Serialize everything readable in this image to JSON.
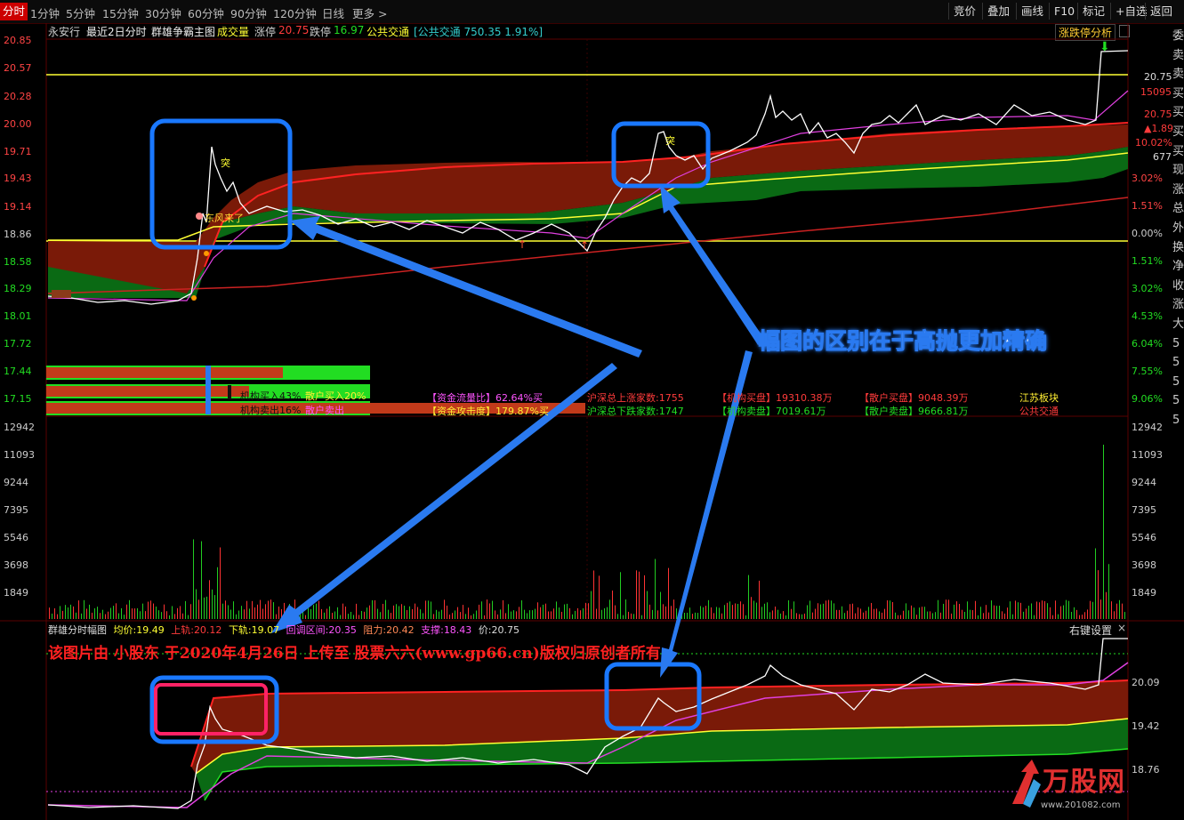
{
  "toolbar": {
    "periods": [
      "分时",
      "1分钟",
      "5分钟",
      "15分钟",
      "30分钟",
      "60分钟",
      "90分钟",
      "120分钟",
      "日线",
      "更多 >"
    ],
    "buttons": [
      "竞价",
      "叠加",
      "画线",
      "F10",
      "标记",
      "+自选",
      "返回"
    ]
  },
  "info": {
    "stock_name": "永安行",
    "range": "最近2日分时",
    "indicator": "群雄争霸主图",
    "volume_label": "成交量",
    "limit_up_label": "涨停",
    "limit_up_value": "20.75",
    "limit_down_label": "跌停",
    "limit_down_value": "16.97",
    "sector": "公共交通",
    "sector_quote": "[公共交通 750.35 1.91%]",
    "analysis_btn": "涨跌停分析"
  },
  "left_axis": [
    "20.85",
    "20.57",
    "20.28",
    "20.00",
    "19.71",
    "19.43",
    "19.14",
    "18.86",
    "18.58",
    "18.29",
    "18.01",
    "17.72",
    "17.44",
    "17.15"
  ],
  "right_axis": {
    "pct": [
      "3.02%",
      "1.51%",
      "0.00%",
      "1.51%",
      "3.02%",
      "4.53%",
      "6.04%",
      "7.55%",
      "9.06%"
    ],
    "labels": [
      "20.75",
      "15095",
      "20.75",
      "▲1.89",
      "10.02%",
      "677"
    ]
  },
  "side_chars": [
    "委",
    "卖",
    "卖",
    "买",
    "买",
    "买",
    "买",
    "现",
    "涨",
    "总",
    "外",
    "换",
    "净",
    "收",
    "涨",
    "大",
    "5",
    "5",
    "5",
    "5",
    "5"
  ],
  "stats": {
    "inst_buy": "机构买入43%",
    "retail_buy": "散户买入20%",
    "inst_sell": "机构卖出16%",
    "retail_sell": "散户卖出",
    "fund_flow": "【资金流量比】62.64%买",
    "fund_attack": "【资金攻击度】179.87%买",
    "up_count": "沪深总上涨家数:1755",
    "down_count": "沪深总下跌家数:1747",
    "inst_buy_amt": "【机构买盘】19310.38万",
    "inst_sell_amt": "【机构卖盘】7019.61万",
    "retail_buy_amt": "【散户买盘】9048.39万",
    "retail_sell_amt": "【散户卖盘】9666.81万",
    "board": "江苏板块",
    "board_sector": "公共交通"
  },
  "volume_axis": [
    "12942",
    "11093",
    "9244",
    "7395",
    "5546",
    "3698",
    "1849"
  ],
  "sub_chart": {
    "title": "群雄分时幅图",
    "avg_label": "均价:",
    "avg": "19.49",
    "upper_label": "上轨:",
    "upper": "20.12",
    "lower_label": "下轨:",
    "lower": "19.07",
    "zone_label": "回调区间:",
    "zone": "20.35",
    "resist_label": "阻力:",
    "resist": "20.42",
    "support_label": "支撑:",
    "support": "18.43",
    "price_label": "价:",
    "price": "20.75",
    "settings": "右键设置",
    "close": "×",
    "axis": [
      "20.09",
      "19.42",
      "18.76"
    ]
  },
  "annotations": {
    "callout": "幅图的区别在于高抛更加精确",
    "signal_tu": "突",
    "signal_dongfeng": "东风来了",
    "watermark": "该图片由 小股东 于2020年4月26日 上传至 股票六六(www.gp66.cn)版权归原创者所有",
    "logo": "万股网",
    "logo_url": "www.201082.com"
  },
  "colors": {
    "up": "#ff3b3b",
    "down": "#22dd22",
    "price": "#ffffff",
    "avg": "#e040e0",
    "band_red": "#7a1a08",
    "band_green": "#0a6a14",
    "arrow": "#2a7af0",
    "box": "#1a78ff",
    "yellow": "#ffff33"
  }
}
